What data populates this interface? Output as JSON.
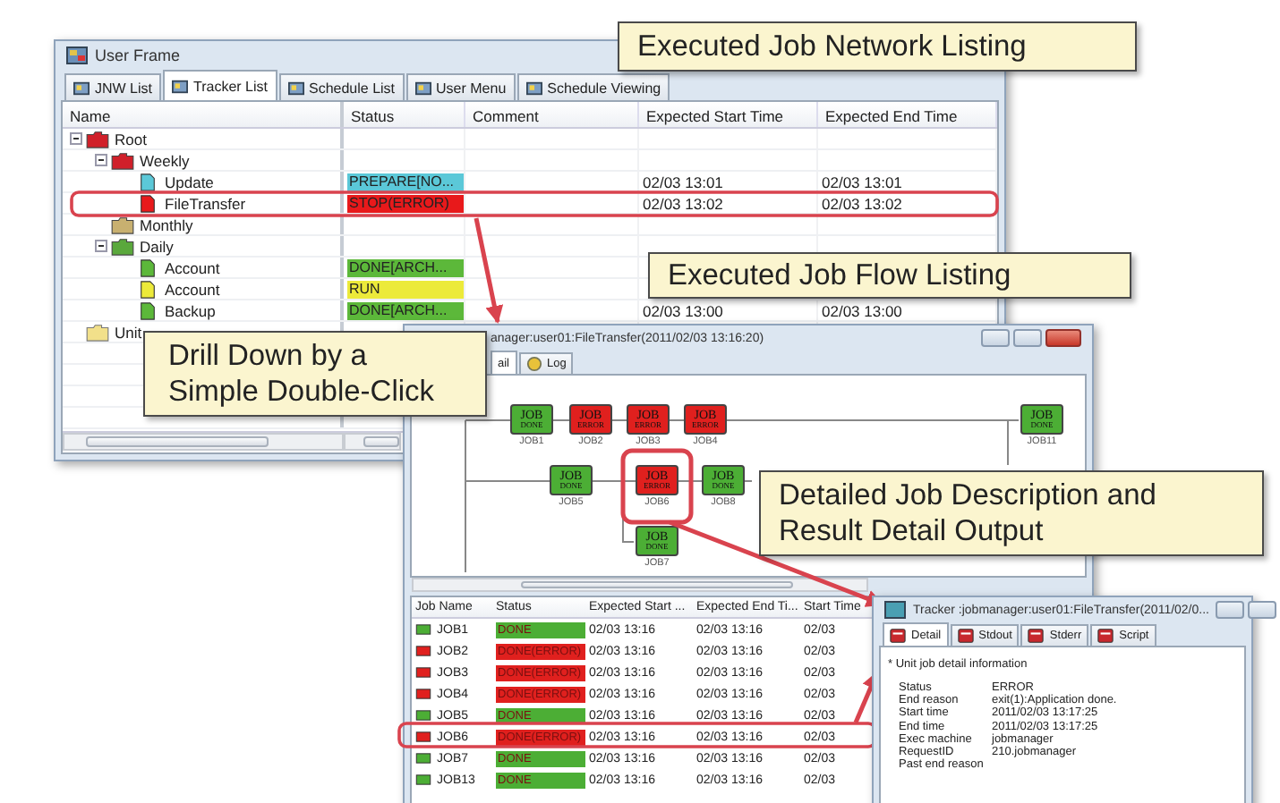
{
  "network_window": {
    "title": "User Frame",
    "tabs": [
      {
        "label": "JNW List",
        "selected": false
      },
      {
        "label": "Tracker List",
        "selected": true
      },
      {
        "label": "Schedule List",
        "selected": false
      },
      {
        "label": "User Menu",
        "selected": false
      },
      {
        "label": "Schedule Viewing",
        "selected": false
      }
    ],
    "columns": [
      "Name",
      "Status",
      "Comment",
      "Expected Start Time",
      "Expected End Time"
    ],
    "tree": [
      {
        "name": "Root",
        "kind": "network",
        "color": "#d0202a",
        "expanded": true,
        "children": [
          {
            "name": "Weekly",
            "kind": "network",
            "color": "#d0202a",
            "expanded": true,
            "children": [
              {
                "name": "Update",
                "kind": "job",
                "color": "#5bc8d8",
                "status": "PREPARE[NO...",
                "start": "02/03 13:01",
                "end": "02/03 13:01"
              },
              {
                "name": "FileTransfer",
                "kind": "job",
                "color": "#e8191b",
                "status": "STOP(ERROR)",
                "start": "02/03 13:02",
                "end": "02/03 13:02"
              }
            ]
          },
          {
            "name": "Monthly",
            "kind": "network",
            "color": "#c8b070"
          },
          {
            "name": "Daily",
            "kind": "network",
            "color": "#5aa83c",
            "expanded": true,
            "children": [
              {
                "name": "Account",
                "kind": "job",
                "color": "#5cb83a",
                "status": "DONE[ARCH..."
              },
              {
                "name": "Account",
                "kind": "job",
                "color": "#ecea3a",
                "status": "RUN"
              },
              {
                "name": "Backup",
                "kind": "job",
                "color": "#5cb83a",
                "status": "DONE[ARCH...",
                "start": "02/03 13:00",
                "end": "02/03 13:00"
              }
            ]
          }
        ]
      },
      {
        "name": "Unit",
        "kind": "folder",
        "color": "#f2e08a"
      }
    ]
  },
  "flow_window": {
    "title": "anager:user01:FileTransfer(2011/02/03 13:16:20)",
    "tabs": [
      {
        "label": "ail",
        "selected": true
      },
      {
        "label": "Log",
        "selected": false
      }
    ],
    "nodes": [
      {
        "name": "JOB1",
        "top": "JOB",
        "bottom": "DONE",
        "kind": "done"
      },
      {
        "name": "JOB2",
        "top": "JOB",
        "bottom": "ERROR",
        "kind": "error"
      },
      {
        "name": "JOB3",
        "top": "JOB",
        "bottom": "ERROR",
        "kind": "error"
      },
      {
        "name": "JOB4",
        "top": "JOB",
        "bottom": "ERROR",
        "kind": "error"
      },
      {
        "name": "JOB11",
        "top": "JOB",
        "bottom": "DONE",
        "kind": "done"
      },
      {
        "name": "JOB5",
        "top": "JOB",
        "bottom": "DONE",
        "kind": "done"
      },
      {
        "name": "JOB6",
        "top": "JOB",
        "bottom": "ERROR",
        "kind": "error"
      },
      {
        "name": "JOB8",
        "top": "JOB",
        "bottom": "DONE",
        "kind": "done"
      },
      {
        "name": "JOB7",
        "top": "JOB",
        "bottom": "DONE",
        "kind": "done"
      }
    ],
    "columns": [
      "Job Name",
      "Status",
      "Expected Start ...",
      "Expected End Ti...",
      "Start Time"
    ],
    "jobs": [
      {
        "name": "JOB1",
        "status": "DONE",
        "kind": "done",
        "start": "02/03 13:16",
        "end": "02/03 13:16",
        "start_time": "02/03"
      },
      {
        "name": "JOB2",
        "status": "DONE(ERROR)",
        "kind": "error",
        "start": "02/03 13:16",
        "end": "02/03 13:16",
        "start_time": "02/03"
      },
      {
        "name": "JOB3",
        "status": "DONE(ERROR)",
        "kind": "error",
        "start": "02/03 13:16",
        "end": "02/03 13:16",
        "start_time": "02/03"
      },
      {
        "name": "JOB4",
        "status": "DONE(ERROR)",
        "kind": "error",
        "start": "02/03 13:16",
        "end": "02/03 13:16",
        "start_time": "02/03"
      },
      {
        "name": "JOB5",
        "status": "DONE",
        "kind": "done",
        "start": "02/03 13:16",
        "end": "02/03 13:16",
        "start_time": "02/03"
      },
      {
        "name": "JOB6",
        "status": "DONE(ERROR)",
        "kind": "error",
        "start": "02/03 13:16",
        "end": "02/03 13:16",
        "start_time": "02/03"
      },
      {
        "name": "JOB7",
        "status": "DONE",
        "kind": "done",
        "start": "02/03 13:16",
        "end": "02/03 13:16",
        "start_time": "02/03"
      },
      {
        "name": "JOB13",
        "status": "DONE",
        "kind": "done",
        "start": "02/03 13:16",
        "end": "02/03 13:16",
        "start_time": "02/03"
      }
    ]
  },
  "detail_window": {
    "title": "Tracker :jobmanager:user01:FileTransfer(2011/02/0...",
    "tabs": [
      {
        "label": "Detail",
        "selected": true
      },
      {
        "label": "Stdout",
        "selected": false
      },
      {
        "label": "Stderr",
        "selected": false
      },
      {
        "label": "Script",
        "selected": false
      }
    ],
    "heading": "* Unit job detail information",
    "fields": [
      {
        "label": "Status",
        "value": "ERROR"
      },
      {
        "label": "End reason",
        "value": "exit(1):Application done."
      },
      {
        "label": "Start time",
        "value": "2011/02/03 13:17:25"
      },
      {
        "label": "End time",
        "value": "2011/02/03 13:17:25"
      },
      {
        "label": "Exec machine",
        "value": "jobmanager"
      },
      {
        "label": "RequestID",
        "value": "210.jobmanager"
      },
      {
        "label": "Past end reason"
      }
    ]
  },
  "callouts": [
    "Executed Job Network Listing",
    "Executed Job Flow Listing",
    "Drill Down by a Simple Double-Click",
    "Detailed Job Description and Result Detail Output"
  ]
}
